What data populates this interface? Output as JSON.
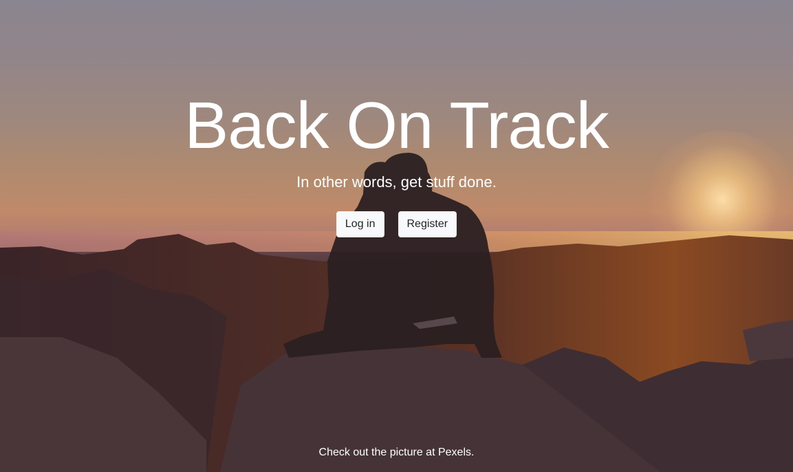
{
  "hero": {
    "title": "Back On Track",
    "subtitle": "In other words, get stuff done.",
    "background_image": "sunset-couple-photo"
  },
  "actions": {
    "login_label": "Log in",
    "register_label": "Register"
  },
  "footer": {
    "credit_prefix": "Check out the picture at ",
    "credit_link": "Pexels",
    "credit_suffix": "."
  },
  "colors": {
    "text": "#ffffff",
    "button_bg": "#f8f9fa",
    "button_text": "#212529"
  }
}
